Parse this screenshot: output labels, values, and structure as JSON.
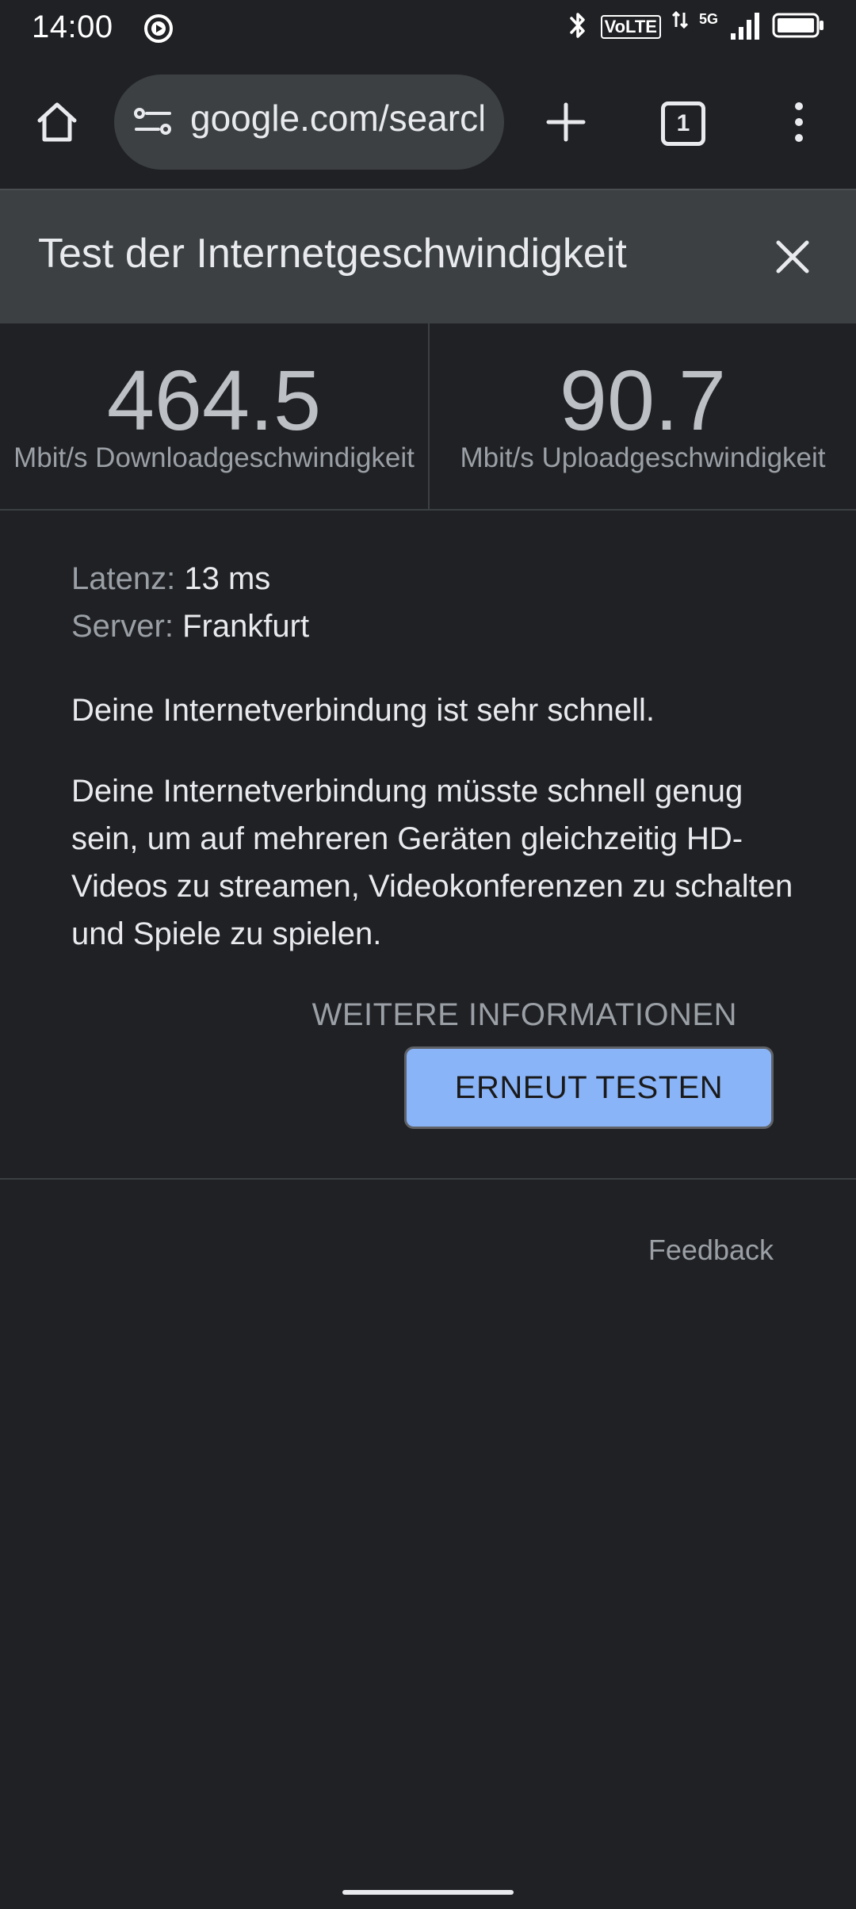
{
  "status_bar": {
    "time": "14:00",
    "volte": "VoLTE",
    "network": "5G",
    "icons": [
      "media-playing-icon",
      "bluetooth-icon",
      "data-arrows-icon",
      "signal-icon",
      "battery-icon"
    ]
  },
  "toolbar": {
    "url": "google.com/search",
    "tab_count": "1",
    "icons": [
      "home-icon",
      "tune-icon",
      "plus-icon",
      "tab-switcher-icon",
      "more-vert-icon"
    ]
  },
  "speed_test": {
    "title": "Test der Internetgeschwindigkeit",
    "download": {
      "value": "464.5",
      "label": "Mbit/s Downloadgeschwindigkeit"
    },
    "upload": {
      "value": "90.7",
      "label": "Mbit/s Uploadgeschwindigkeit"
    },
    "latency": {
      "label": "Latenz:",
      "value": "13 ms"
    },
    "server": {
      "label": "Server:",
      "value": "Frankfurt"
    },
    "summary": "Deine Internetverbindung ist sehr schnell.",
    "description": "Deine Internetverbindung müsste schnell genug sein, um auf mehreren Geräten gleichzeitig HD-Videos zu streamen, Videokonferenzen zu schalten und Spiele zu spielen.",
    "more_info_label": "WEITERE INFORMATIONEN",
    "retest_label": "ERNEUT TESTEN",
    "feedback_label": "Feedback"
  },
  "colors": {
    "background": "#202124",
    "header_background": "#3c4043",
    "accent_button": "#8ab4f8"
  }
}
